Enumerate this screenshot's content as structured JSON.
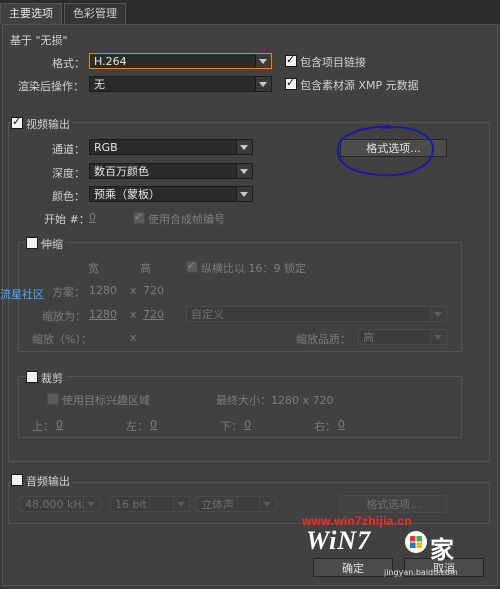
{
  "tabs": {
    "main": "主要选项",
    "color": "色彩管理"
  },
  "based_on": {
    "title": "基于 \"无损\"",
    "format_label": "格式：",
    "format_value": "H.264",
    "render_label": "渲染后操作：",
    "render_value": "无",
    "include_project_link": "包含项目链接",
    "include_xmp": "包含素材源 XMP 元数据"
  },
  "video": {
    "title": "视频输出",
    "channel_label": "通道：",
    "channel_value": "RGB",
    "depth_label": "深度：",
    "depth_value": "数百万颜色",
    "color_label": "颜色：",
    "color_value": "预乘（蒙板）",
    "start_label": "开始 #：",
    "start_value": "0",
    "use_comp_frame": "使用合成帧编号",
    "format_options_button": "格式选项..."
  },
  "stretch": {
    "title": "伸缩",
    "width_header": "宽",
    "height_header": "高",
    "lock_aspect": "纵横比以 16：9 锁定",
    "rendering_label": "方案：",
    "rendering_w": "1280",
    "rendering_x": "x",
    "rendering_h": "720",
    "stretch_to_label": "缩放为：",
    "stretch_to_w": "1280",
    "stretch_to_x": "x",
    "stretch_to_h": "720",
    "custom_value": "自定义",
    "stretch_pct_label": "缩放（%）：",
    "stretch_pct_x": "x",
    "quality_label": "缩放品质：",
    "quality_value": "高"
  },
  "crop": {
    "title": "裁剪",
    "use_roi": "使用目标兴趣区域",
    "final_size": "最终大小：1280 x 720",
    "top_label": "上：",
    "top_value": "0",
    "left_label": "左：",
    "left_value": "0",
    "bottom_label": "下：",
    "bottom_value": "0",
    "right_label": "右：",
    "right_value": "0"
  },
  "audio": {
    "title": "音频输出",
    "rate_value": "48.000 kHz",
    "bits_value": "16 bit",
    "channels_value": "立体声",
    "format_options_button": "格式选项..."
  },
  "footer": {
    "ok_button": "确定",
    "cancel_button": "取消"
  },
  "overlay": {
    "side_text": "流星社区",
    "watermark_url": "www.win7zhijia.cn",
    "watermark_brand": "WiN7",
    "watermark_brand_cn": "家",
    "watermark_small": "jingyan.baidu.com"
  },
  "colors": {
    "panel": "#414141",
    "focus_orange": "#d88a1a",
    "annotation_blue": "#1a1aa8",
    "watermark_red": "#ff2828",
    "side_text_blue": "#4aa9ff"
  }
}
